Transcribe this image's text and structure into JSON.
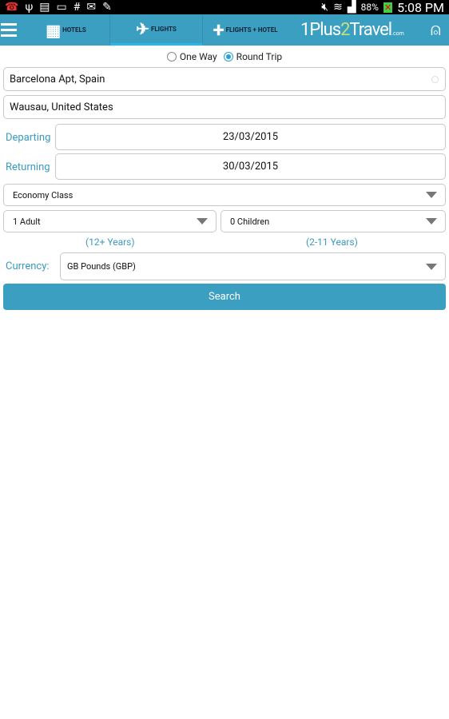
{
  "status": {
    "battery": "88%",
    "time": "5:08 PM",
    "icons": [
      "missed-call-icon",
      "usb-icon",
      "sim-icon",
      "screen-check-icon",
      "hash-icon",
      "mail-icon",
      "pencil-icon",
      "mute-icon",
      "wifi-icon",
      "signal-icon",
      "battery-icon"
    ]
  },
  "nav": {
    "tabs": [
      {
        "label": "HOTELS",
        "icon": "building-icon"
      },
      {
        "label": "FLIGHTS",
        "icon": "plane-icon"
      },
      {
        "label": "FLIGHTS + HOTEL",
        "icon": "plus-icon"
      }
    ],
    "active_tab": "FLIGHTS",
    "logo": {
      "part1": "1Plus",
      "part2": "2",
      "part3": "Travel",
      "suffix": ".com"
    }
  },
  "trip": {
    "one_way": "One Way",
    "round_trip": "Round Trip",
    "selected": "Round Trip"
  },
  "form": {
    "from": "Barcelona Apt, Spain",
    "to": "Wausau, United States",
    "departing_label": "Departing",
    "departing": "23/03/2015",
    "returning_label": "Returning",
    "returning": "30/03/2015",
    "cabin": "Economy Class",
    "adults": "1 Adult",
    "children": "0 Children",
    "adult_age": "(12+ Years)",
    "child_age": "(2-11 Years)",
    "currency_label": "Currency:",
    "currency": "GB Pounds (GBP)",
    "search": "Search"
  },
  "colors": {
    "accent": "#3b9fc2",
    "label": "#3a9ac0"
  }
}
